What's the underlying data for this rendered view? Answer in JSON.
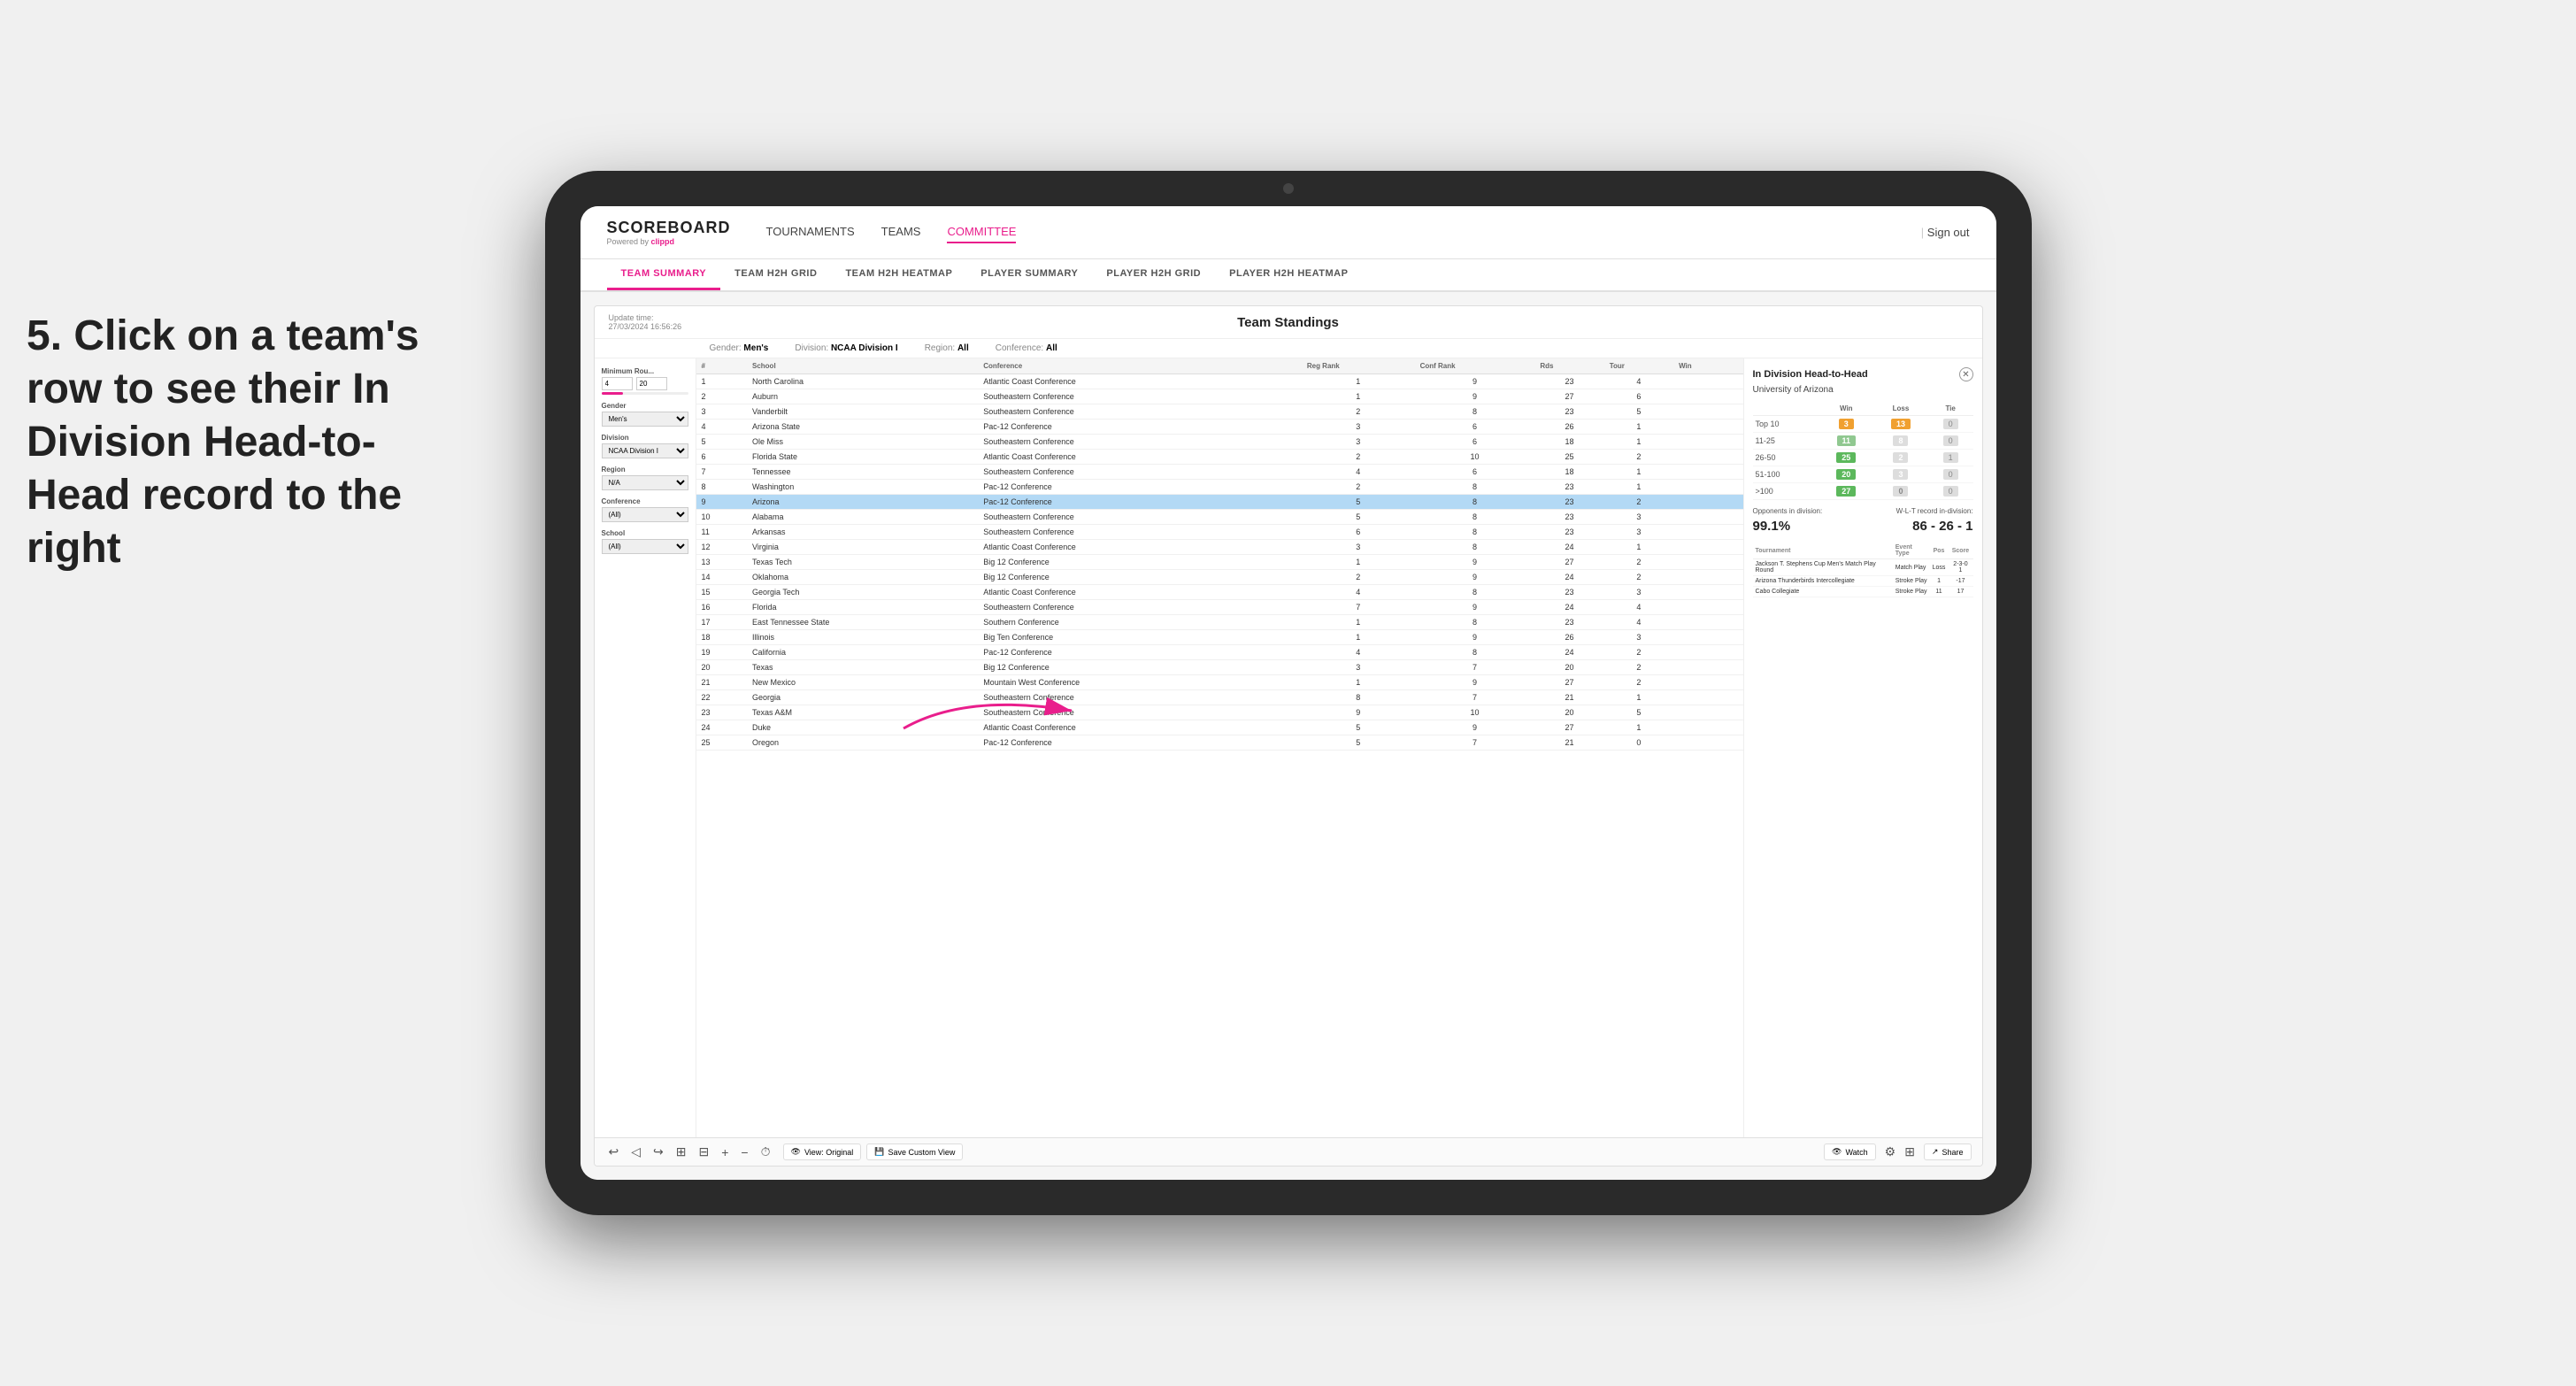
{
  "page": {
    "background": "#e8e8e8"
  },
  "annotation": {
    "text": "5. Click on a team's row to see their In Division Head-to-Head record to the right"
  },
  "top_nav": {
    "logo": "SCOREBOARD",
    "logo_sub": "Powered by",
    "logo_brand": "clippd",
    "links": [
      "TOURNAMENTS",
      "TEAMS",
      "COMMITTEE"
    ],
    "active_link": "COMMITTEE",
    "sign_out": "Sign out"
  },
  "sub_nav": {
    "links": [
      "TEAM SUMMARY",
      "TEAM H2H GRID",
      "TEAM H2H HEATMAP",
      "PLAYER SUMMARY",
      "PLAYER H2H GRID",
      "PLAYER H2H HEATMAP"
    ],
    "active": "PLAYER SUMMARY"
  },
  "panel": {
    "title": "Team Standings",
    "update_time": "Update time:",
    "update_date": "27/03/2024 16:56:26",
    "gender_label": "Gender:",
    "gender_value": "Men's",
    "division_label": "Division:",
    "division_value": "NCAA Division I",
    "region_label": "Region:",
    "region_value": "All",
    "conference_label": "Conference:",
    "conference_value": "All"
  },
  "filters": {
    "minimum_rounds_label": "Minimum Rou...",
    "min_value": "4",
    "max_value": "20",
    "gender_label": "Gender",
    "gender_value": "Men's",
    "division_label": "Division",
    "division_value": "NCAA Division I",
    "region_label": "Region",
    "region_value": "N/A",
    "conference_label": "Conference",
    "conference_value": "(All)",
    "school_label": "School",
    "school_value": "(All)"
  },
  "table": {
    "headers": [
      "#",
      "School",
      "Conference",
      "Reg Rank",
      "Conf Rank",
      "Rds",
      "Tour",
      "Win"
    ],
    "rows": [
      {
        "rank": "1",
        "school": "North Carolina",
        "conference": "Atlantic Coast Conference",
        "reg_rank": "1",
        "conf_rank": "9",
        "rds": "23",
        "tour": "4",
        "win": ""
      },
      {
        "rank": "2",
        "school": "Auburn",
        "conference": "Southeastern Conference",
        "reg_rank": "1",
        "conf_rank": "9",
        "rds": "27",
        "tour": "6",
        "win": ""
      },
      {
        "rank": "3",
        "school": "Vanderbilt",
        "conference": "Southeastern Conference",
        "reg_rank": "2",
        "conf_rank": "8",
        "rds": "23",
        "tour": "5",
        "win": ""
      },
      {
        "rank": "4",
        "school": "Arizona State",
        "conference": "Pac-12 Conference",
        "reg_rank": "3",
        "conf_rank": "6",
        "rds": "26",
        "tour": "1",
        "win": ""
      },
      {
        "rank": "5",
        "school": "Ole Miss",
        "conference": "Southeastern Conference",
        "reg_rank": "3",
        "conf_rank": "6",
        "rds": "18",
        "tour": "1",
        "win": ""
      },
      {
        "rank": "6",
        "school": "Florida State",
        "conference": "Atlantic Coast Conference",
        "reg_rank": "2",
        "conf_rank": "10",
        "rds": "25",
        "tour": "2",
        "win": ""
      },
      {
        "rank": "7",
        "school": "Tennessee",
        "conference": "Southeastern Conference",
        "reg_rank": "4",
        "conf_rank": "6",
        "rds": "18",
        "tour": "1",
        "win": ""
      },
      {
        "rank": "8",
        "school": "Washington",
        "conference": "Pac-12 Conference",
        "reg_rank": "2",
        "conf_rank": "8",
        "rds": "23",
        "tour": "1",
        "win": ""
      },
      {
        "rank": "9",
        "school": "Arizona",
        "conference": "Pac-12 Conference",
        "reg_rank": "5",
        "conf_rank": "8",
        "rds": "23",
        "tour": "2",
        "win": "",
        "highlighted": true
      },
      {
        "rank": "10",
        "school": "Alabama",
        "conference": "Southeastern Conference",
        "reg_rank": "5",
        "conf_rank": "8",
        "rds": "23",
        "tour": "3",
        "win": ""
      },
      {
        "rank": "11",
        "school": "Arkansas",
        "conference": "Southeastern Conference",
        "reg_rank": "6",
        "conf_rank": "8",
        "rds": "23",
        "tour": "3",
        "win": ""
      },
      {
        "rank": "12",
        "school": "Virginia",
        "conference": "Atlantic Coast Conference",
        "reg_rank": "3",
        "conf_rank": "8",
        "rds": "24",
        "tour": "1",
        "win": ""
      },
      {
        "rank": "13",
        "school": "Texas Tech",
        "conference": "Big 12 Conference",
        "reg_rank": "1",
        "conf_rank": "9",
        "rds": "27",
        "tour": "2",
        "win": ""
      },
      {
        "rank": "14",
        "school": "Oklahoma",
        "conference": "Big 12 Conference",
        "reg_rank": "2",
        "conf_rank": "9",
        "rds": "24",
        "tour": "2",
        "win": ""
      },
      {
        "rank": "15",
        "school": "Georgia Tech",
        "conference": "Atlantic Coast Conference",
        "reg_rank": "4",
        "conf_rank": "8",
        "rds": "23",
        "tour": "3",
        "win": ""
      },
      {
        "rank": "16",
        "school": "Florida",
        "conference": "Southeastern Conference",
        "reg_rank": "7",
        "conf_rank": "9",
        "rds": "24",
        "tour": "4",
        "win": ""
      },
      {
        "rank": "17",
        "school": "East Tennessee State",
        "conference": "Southern Conference",
        "reg_rank": "1",
        "conf_rank": "8",
        "rds": "23",
        "tour": "4",
        "win": ""
      },
      {
        "rank": "18",
        "school": "Illinois",
        "conference": "Big Ten Conference",
        "reg_rank": "1",
        "conf_rank": "9",
        "rds": "26",
        "tour": "3",
        "win": ""
      },
      {
        "rank": "19",
        "school": "California",
        "conference": "Pac-12 Conference",
        "reg_rank": "4",
        "conf_rank": "8",
        "rds": "24",
        "tour": "2",
        "win": ""
      },
      {
        "rank": "20",
        "school": "Texas",
        "conference": "Big 12 Conference",
        "reg_rank": "3",
        "conf_rank": "7",
        "rds": "20",
        "tour": "2",
        "win": ""
      },
      {
        "rank": "21",
        "school": "New Mexico",
        "conference": "Mountain West Conference",
        "reg_rank": "1",
        "conf_rank": "9",
        "rds": "27",
        "tour": "2",
        "win": ""
      },
      {
        "rank": "22",
        "school": "Georgia",
        "conference": "Southeastern Conference",
        "reg_rank": "8",
        "conf_rank": "7",
        "rds": "21",
        "tour": "1",
        "win": ""
      },
      {
        "rank": "23",
        "school": "Texas A&M",
        "conference": "Southeastern Conference",
        "reg_rank": "9",
        "conf_rank": "10",
        "rds": "20",
        "tour": "5",
        "win": ""
      },
      {
        "rank": "24",
        "school": "Duke",
        "conference": "Atlantic Coast Conference",
        "reg_rank": "5",
        "conf_rank": "9",
        "rds": "27",
        "tour": "1",
        "win": ""
      },
      {
        "rank": "25",
        "school": "Oregon",
        "conference": "Pac-12 Conference",
        "reg_rank": "5",
        "conf_rank": "7",
        "rds": "21",
        "tour": "0",
        "win": ""
      }
    ]
  },
  "h2h_panel": {
    "title": "In Division Head-to-Head",
    "team": "University of Arizona",
    "win_label": "Win",
    "loss_label": "Loss",
    "tie_label": "Tie",
    "rows": [
      {
        "range": "Top 10",
        "win": "3",
        "loss": "13",
        "tie": "0",
        "win_class": "cell-orange",
        "loss_class": "cell-orange"
      },
      {
        "range": "11-25",
        "win": "11",
        "loss": "8",
        "tie": "0",
        "win_class": "cell-light-green",
        "loss_class": "cell-gray"
      },
      {
        "range": "26-50",
        "win": "25",
        "loss": "2",
        "tie": "1",
        "win_class": "cell-green",
        "loss_class": "cell-gray"
      },
      {
        "range": "51-100",
        "win": "20",
        "loss": "3",
        "tie": "0",
        "win_class": "cell-green",
        "loss_class": "cell-gray"
      },
      {
        "range": ">100",
        "win": "27",
        "loss": "0",
        "tie": "0",
        "win_class": "cell-green",
        "loss_class": "cell-gray"
      }
    ],
    "opponents_pct_label": "Opponents in division:",
    "opponents_pct": "99.1%",
    "wlt_label": "W-L-T record in-division:",
    "wlt_record": "86 - 26 - 1",
    "tournament_headers": [
      "Tournament",
      "Event Type",
      "Pos",
      "Score"
    ],
    "tournament_rows": [
      {
        "name": "Jackson T. Stephens Cup Men's Match Play Round",
        "type": "Match Play",
        "result": "Loss",
        "score": "2-3-0 1"
      },
      {
        "name": "Arizona Thunderbirds Intercollegiate",
        "type": "Stroke Play",
        "pos": "1",
        "score": "-17"
      },
      {
        "name": "Cabo Collegiate",
        "type": "Stroke Play",
        "pos": "11",
        "score": "17"
      }
    ]
  },
  "toolbar": {
    "view_original": "View: Original",
    "save_custom": "Save Custom View",
    "watch": "Watch",
    "share": "Share"
  }
}
